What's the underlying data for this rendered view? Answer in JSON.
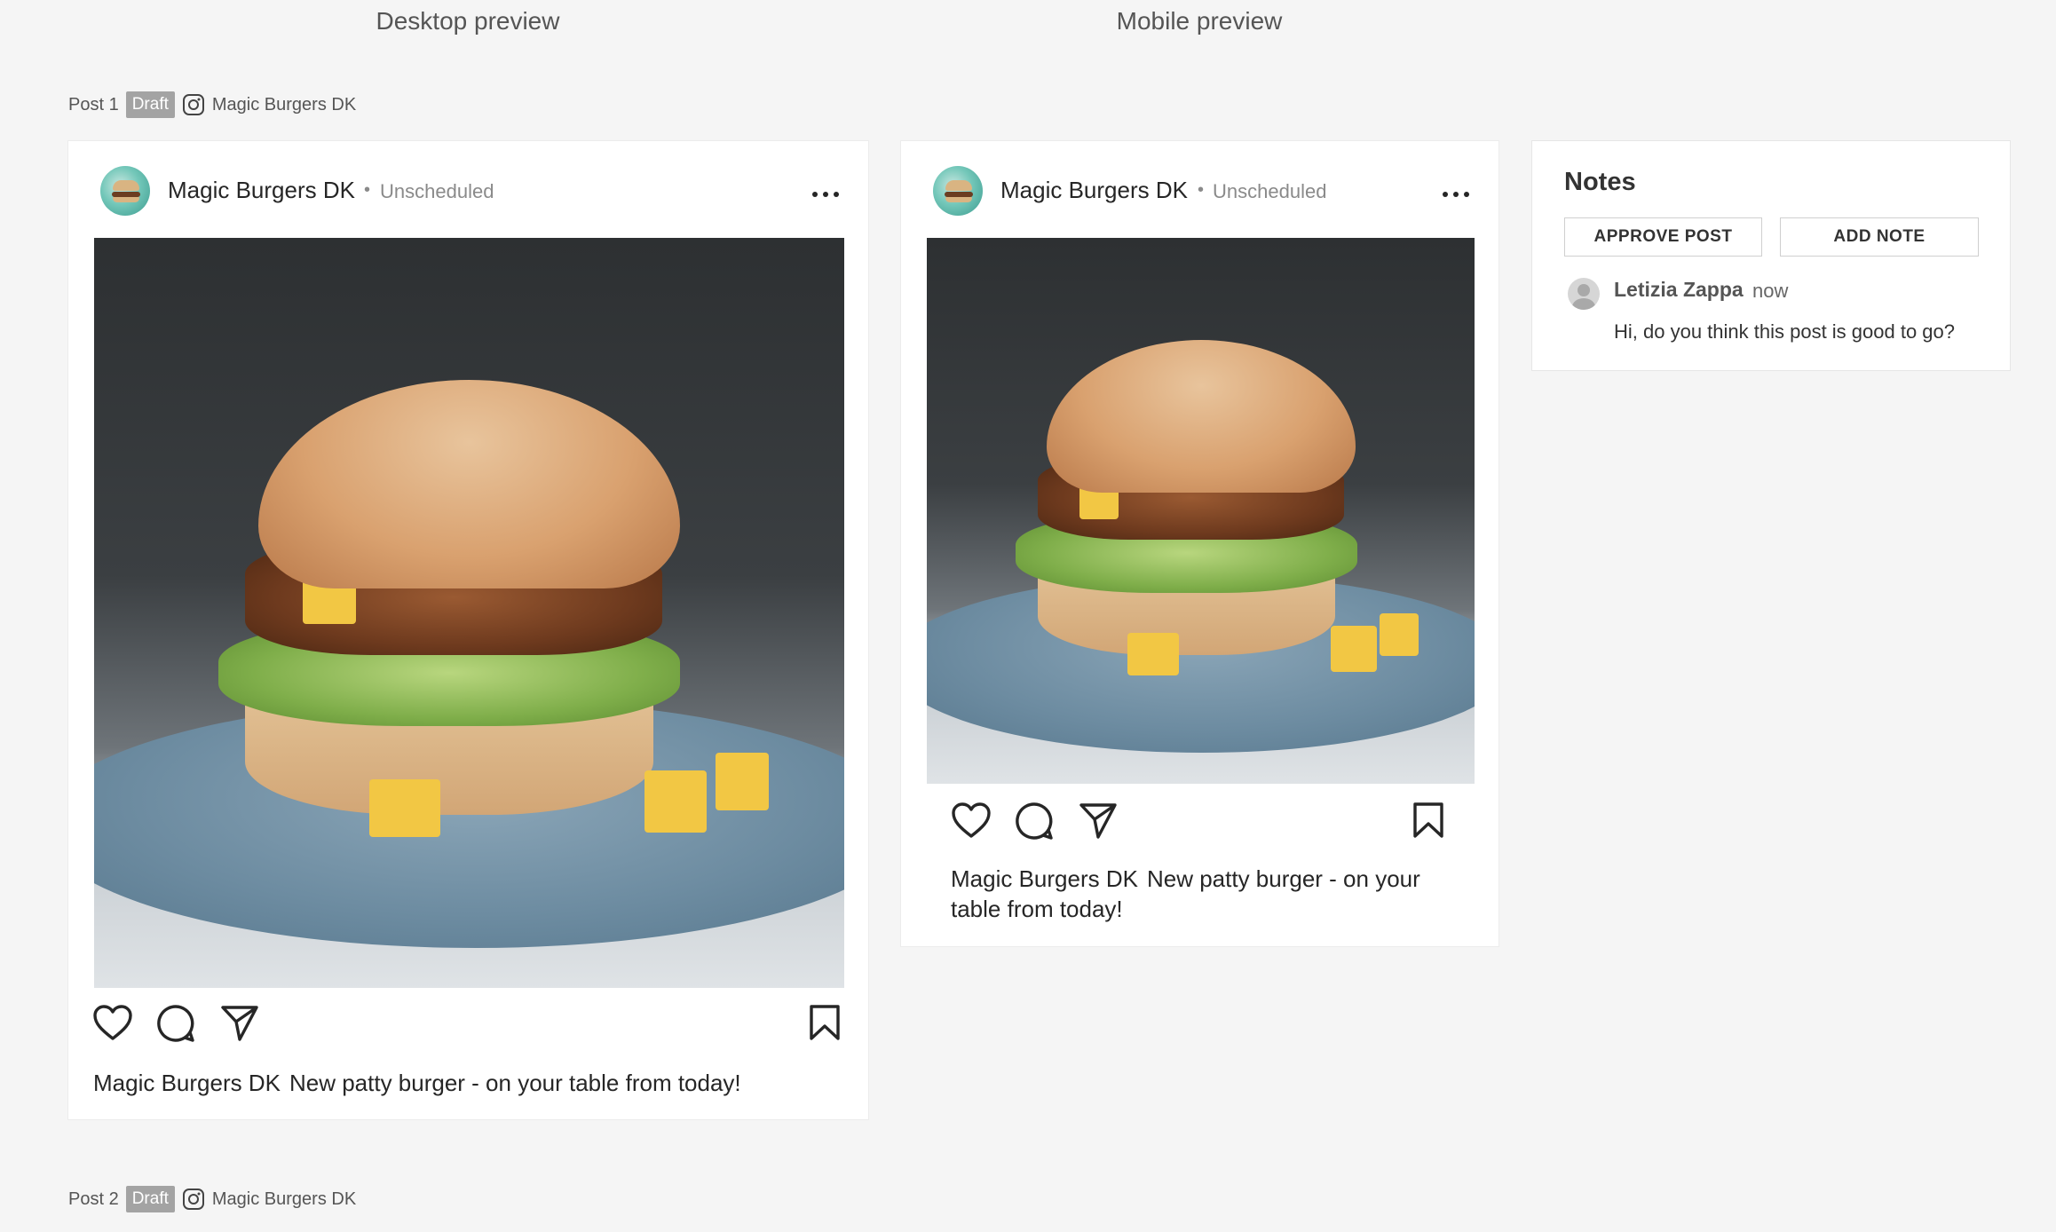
{
  "columns": {
    "desktop_label": "Desktop preview",
    "mobile_label": "Mobile preview"
  },
  "posts": [
    {
      "label": "Post 1",
      "status": "Draft",
      "account": "Magic Burgers DK"
    },
    {
      "label": "Post 2",
      "status": "Draft",
      "account": "Magic Burgers DK"
    }
  ],
  "preview": {
    "account_name": "Magic Burgers DK",
    "separator": "•",
    "schedule": "Unscheduled",
    "caption_name": "Magic Burgers DK",
    "caption_text": "New patty burger - on your table from today!",
    "mobile_caption_line1": "New patty burger - on your",
    "mobile_caption_line2": "table from today!"
  },
  "notes": {
    "title": "Notes",
    "approve_label": "APPROVE POST",
    "add_note_label": "ADD NOTE",
    "items": [
      {
        "author": "Letizia Zappa",
        "time": "now",
        "text": "Hi, do you think this post is good to go?"
      }
    ]
  }
}
